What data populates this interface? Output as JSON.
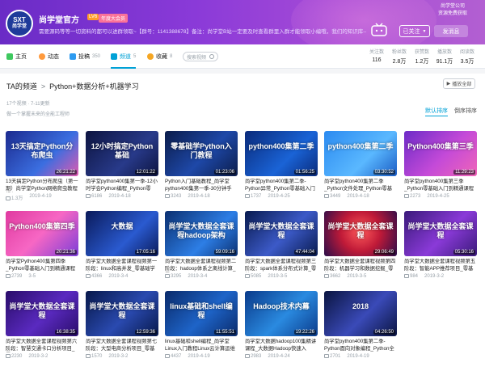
{
  "header": {
    "avatar_text": "SXT",
    "avatar_sub": "尚学堂",
    "up_name": "尚学堂官方",
    "level_badge": "LV6",
    "vip_badge": "年度大会员",
    "sign": "需要源码等等一切资料的都可以进群领取~【群号：1141388678】备注：尚学堂B站一定要及时查看群里入群才能领取小编哦，我们的知识库--点亮你的知识库--您的知识库~点它",
    "corner_link_line1": "尚学堂公司",
    "corner_link_line2": "资源免费获取",
    "followed_label": "已关注",
    "message_label": "发消息",
    "colors": {
      "banner_start": "#6a2bc6",
      "banner_end": "#b25fd2",
      "accent": "#00a1d6"
    }
  },
  "nav": {
    "items": [
      {
        "label": "主页",
        "count": "",
        "icon": "home-icon",
        "color": "#3ec85f"
      },
      {
        "label": "动态",
        "count": "",
        "icon": "dynamic-icon",
        "color": "#ff9a3d"
      },
      {
        "label": "投稿",
        "count": "350",
        "icon": "upload-icon",
        "color": "#2d9bf0"
      },
      {
        "label": "频道",
        "count": "5",
        "icon": "channel-icon",
        "color": "#00a1d6"
      },
      {
        "label": "收藏",
        "count": "8",
        "icon": "favorite-icon",
        "color": "#f5a623"
      }
    ],
    "active_index": 3,
    "search_placeholder": "搜索视频",
    "stats": [
      {
        "label": "关注数",
        "value": "116"
      },
      {
        "label": "粉丝数",
        "value": "2.8万"
      },
      {
        "label": "获赞数",
        "value": "1.2万"
      },
      {
        "label": "播放数",
        "value": "91.1万"
      },
      {
        "label": "阅读数",
        "value": "3.5万"
      }
    ]
  },
  "content": {
    "breadcrumb_root": "TA的频道",
    "breadcrumb_sep": ">",
    "breadcrumb_current": "Python+数据分析+机器学习",
    "play_all_label": "播放全部",
    "video_count_text": "17个视频",
    "update_text": "7-11更新",
    "channel_desc": "做一个掌握未来的全能工程师",
    "sort_default": "默认排序",
    "sort_reverse": "倒序排序"
  },
  "videos": [
    {
      "thumb_text": "13天搞定Python分布爬虫",
      "duration": "26:21:22",
      "title": "13天搞定Python分布爬虫（第一期）尚学堂Python网络爬虫教程视频",
      "plays": "1.3万",
      "date": "2019-4-19",
      "bg": "linear-gradient(135deg,#1b2a8f,#3b6ee0 60%,#e05ab0)"
    },
    {
      "thumb_text": "12小时搞定Python基础",
      "duration": "12:01:22",
      "title": "尚学堂python400集第一季-12小时学会Python编程_Python零",
      "plays": "6186",
      "date": "2019-4-18",
      "bg": "linear-gradient(135deg,#0d1440,#283a8a 60%,#0d1440)"
    },
    {
      "thumb_text": "零基础学Python入门教程",
      "duration": "01:23:06",
      "title": "Python入门基础教程_尚学堂python400集第一季-30分钟手",
      "plays": "3243",
      "date": "2019-4-18",
      "bg": "linear-gradient(135deg,#0b1c4a,#1e48a8 55%,#0b1c4a)"
    },
    {
      "thumb_text": "python400集第二季",
      "duration": "01:56:25",
      "title": "尚学堂python400集第二季-Python异常_Python零基础入门",
      "plays": "1737",
      "date": "2019-4-25",
      "bg": "linear-gradient(135deg,#0a2a7a,#1a63d6 60%,#0a2a7a)"
    },
    {
      "thumb_text": "python400集第二季",
      "duration": "03:30:52",
      "title": "尚学堂python400集第二季_Python文件处理_Python零基",
      "plays": "3449",
      "date": "2019-4-18",
      "bg": "linear-gradient(135deg,#2b8af0,#5ab8ff 60%,#1a5cc4)"
    },
    {
      "thumb_text": "Python400集第三季",
      "duration": "11:29:23",
      "title": "尚学堂python400集第三季_Python零基础入门到精通课程",
      "plays": "2273",
      "date": "2019-4-25",
      "bg": "linear-gradient(135deg,#6d2bc7,#c44ad8 55%,#f065b8)"
    },
    {
      "thumb_text": "Python400集第四季",
      "duration": "20:21:36",
      "title": "尚学堂Python400集第四季_Python零基础入门到精通课程",
      "plays": "2739",
      "date": "3-5",
      "bg": "linear-gradient(135deg,#e03aa0,#f767c4 50%,#7b3ed8)"
    },
    {
      "thumb_text": "大数据",
      "duration": "17:05:16",
      "title": "尚学堂大数据全套课程视频第一阶段：linux和高并发_零基础学大",
      "plays": "4366",
      "date": "2019-3-4",
      "bg": "linear-gradient(135deg,#0a1a5a,#2a5ad0 60%,#0a1a5a)"
    },
    {
      "thumb_text": "尚学堂大数据全套课程hadoop架构",
      "duration": "59:09:16",
      "title": "尚学堂大数据全套课程视频第二阶段：hadoop体系之离线计算_零",
      "plays": "3295",
      "date": "2019-3-4",
      "bg": "linear-gradient(135deg,#0b2f70,#2d7ee6 60%,#0b2f70)"
    },
    {
      "thumb_text": "尚学堂大数据全套课程",
      "duration": "47:44:04",
      "title": "尚学堂大数据全套课程视频第三阶段：spark体系分布式计算_零基",
      "plays": "5085",
      "date": "2019-3-5",
      "bg": "linear-gradient(135deg,#081a4e,#3c5ac8 55%,#081a4e)"
    },
    {
      "thumb_text": "尚学堂大数据全套课程",
      "duration": "29:06:49",
      "title": "尚学堂大数据全套课程视频第四阶段：机器学习和数据挖掘_零基",
      "plays": "3662",
      "date": "2019-3-5",
      "bg": "radial-gradient(circle at 50% 45%,#ff5a5a,#c01a38 45%,#2a0d4a)"
    },
    {
      "thumb_text": "尚学堂大数据全套课程",
      "duration": "05:30:16",
      "title": "尚学堂大数据全套课程视频第五阶段：智能APP推荐项目_零基础",
      "plays": "984",
      "date": "2019-3-2",
      "bg": "linear-gradient(135deg,#3a1a7a,#8a3ad8 55%,#3a1a7a)"
    },
    {
      "thumb_text": "尚学堂大数据全套课程",
      "duration": "16:38:35",
      "title": "尚学堂大数据全套课程视频第六阶段：智慧交通卡口分析项目_零",
      "plays": "2230",
      "date": "2019-3-2",
      "bg": "linear-gradient(135deg,#2a0d6a,#5a2ac0 55%,#2a0d6a)"
    },
    {
      "thumb_text": "尚学堂大数据全套课程",
      "duration": "12:59:36",
      "title": "尚学堂大数据全套课程视频第七阶段：大型电商分析项目_零基础",
      "plays": "1570",
      "date": "2019-3-2",
      "bg": "linear-gradient(135deg,#07184a,#2a4ab0 55%,#07184a)"
    },
    {
      "thumb_text": "linux基础和shell编程",
      "duration": "11:55:51",
      "title": "linux基础和shell编程_尚学堂Linux入门教程Linux云计算运维",
      "plays": "4437",
      "date": "2019-4-19",
      "bg": "linear-gradient(135deg,#0a2a6a,#1e64c8 55%,#0a2a6a)"
    },
    {
      "thumb_text": "Hadoop技术内幕",
      "duration": "19:22:26",
      "title": "尚学堂大数据hadoop100集精讲课程_大数据Hadoop快速入",
      "plays": "2983",
      "date": "2019-4-24",
      "bg": "linear-gradient(135deg,#0a3a8a,#2a8ae0 55%,#0a3a8a)"
    },
    {
      "thumb_text": "2018",
      "duration": "04:26:50",
      "title": "尚学堂python400集第二季-Python面向对象编程_Python全",
      "plays": "2701",
      "date": "2019-4-19",
      "bg": "linear-gradient(135deg,#0a1440,#3a4ab8 55%,#0a1440)"
    }
  ]
}
